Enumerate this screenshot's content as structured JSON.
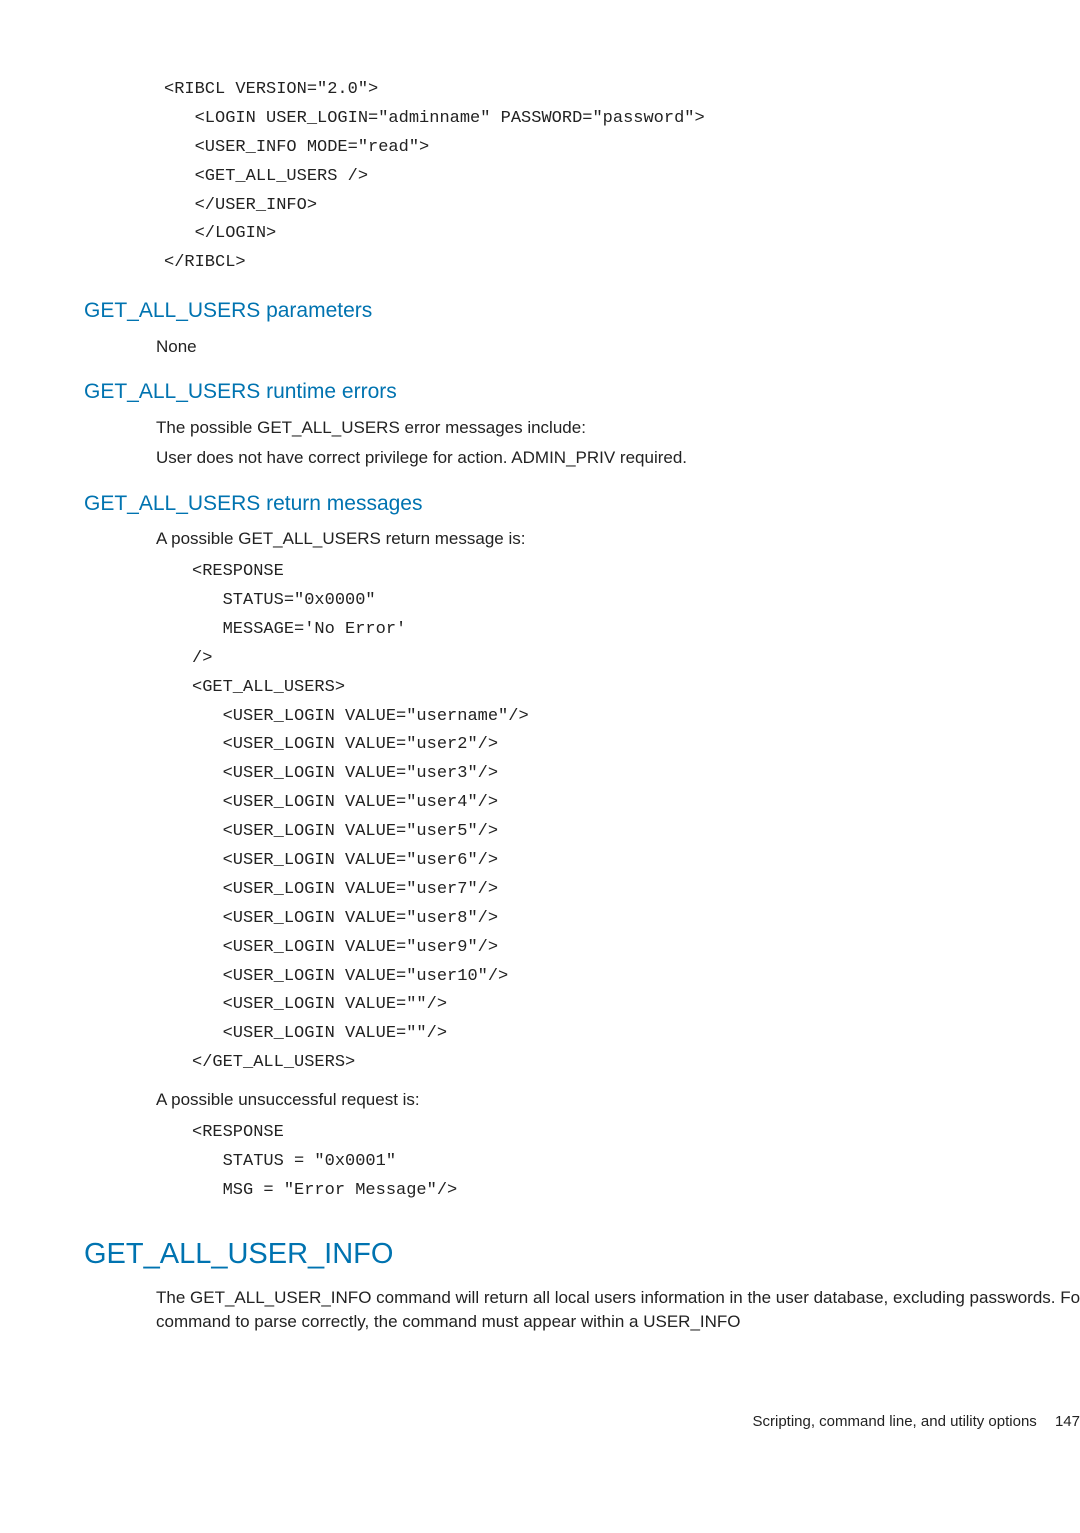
{
  "code1": "<RIBCL VERSION=\"2.0\">\n   <LOGIN USER_LOGIN=\"adminname\" PASSWORD=\"password\">\n   <USER_INFO MODE=\"read\">\n   <GET_ALL_USERS />\n   </USER_INFO>\n   </LOGIN>\n</RIBCL>",
  "sec_params": {
    "heading": "GET_ALL_USERS parameters",
    "body": "None"
  },
  "sec_runtime": {
    "heading": "GET_ALL_USERS runtime errors",
    "line1": "The possible GET_ALL_USERS error messages include:",
    "line2": "User does not have correct privilege for action. ADMIN_PRIV required."
  },
  "sec_return": {
    "heading": "GET_ALL_USERS return messages",
    "intro": "A possible GET_ALL_USERS return message is:",
    "code": "<RESPONSE\n   STATUS=\"0x0000\"\n   MESSAGE='No Error'\n/>\n<GET_ALL_USERS>\n   <USER_LOGIN VALUE=\"username\"/>\n   <USER_LOGIN VALUE=\"user2\"/>\n   <USER_LOGIN VALUE=\"user3\"/>\n   <USER_LOGIN VALUE=\"user4\"/>\n   <USER_LOGIN VALUE=\"user5\"/>\n   <USER_LOGIN VALUE=\"user6\"/>\n   <USER_LOGIN VALUE=\"user7\"/>\n   <USER_LOGIN VALUE=\"user8\"/>\n   <USER_LOGIN VALUE=\"user9\"/>\n   <USER_LOGIN VALUE=\"user10\"/>\n   <USER_LOGIN VALUE=\"\"/>\n   <USER_LOGIN VALUE=\"\"/>\n</GET_ALL_USERS>",
    "fail_intro": "A possible unsuccessful request is:",
    "fail_code": "<RESPONSE\n   STATUS = \"0x0001\"\n   MSG = \"Error Message\"/>"
  },
  "sec_allinfo": {
    "heading": "GET_ALL_USER_INFO",
    "body": "The GET_ALL_USER_INFO command will return all local users information in the user database, excluding passwords. For this command to parse correctly, the command must appear within a USER_INFO"
  },
  "footer": {
    "label": "Scripting, command line, and utility options",
    "page": "147"
  }
}
